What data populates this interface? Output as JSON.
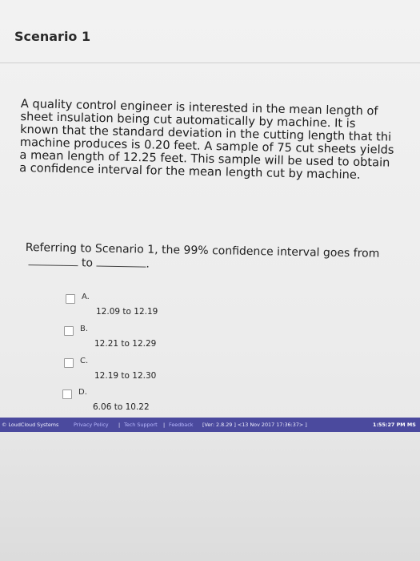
{
  "scenario": {
    "title": "Scenario 1",
    "lines": [
      "A quality control engineer is interested in the mean length of",
      "sheet insulation being cut automatically by machine.  It is",
      "known that the standard deviation in the cutting length that thi",
      "machine produces is 0.20 feet.  A sample of 75 cut sheets yields",
      "a mean length of 12.25 feet. This sample will be used to obtain",
      "a confidence interval for the mean length cut by machine."
    ]
  },
  "question": {
    "line1": "Referring to Scenario 1, the 99% confidence interval goes from",
    "to_word": "to",
    "end_punct": "."
  },
  "options": [
    {
      "letter": "A.",
      "value": "12.09 to 12.19"
    },
    {
      "letter": "B.",
      "value": "12.21 to 12.29"
    },
    {
      "letter": "C.",
      "value": "12.19 to 12.30"
    },
    {
      "letter": "D.",
      "value": "6.06 to 10.22"
    }
  ],
  "footer": {
    "brand": "© LoudCloud Systems",
    "privacy": "Privacy Policy",
    "sep1": "|",
    "tech": "Tech Support",
    "sep2": "|",
    "feedback": "Feedback",
    "version": "[Ver: 2.8.29 ]  <13 Nov 2017 17:36:37>  ]",
    "clock": "1:55:27 PM MS"
  }
}
